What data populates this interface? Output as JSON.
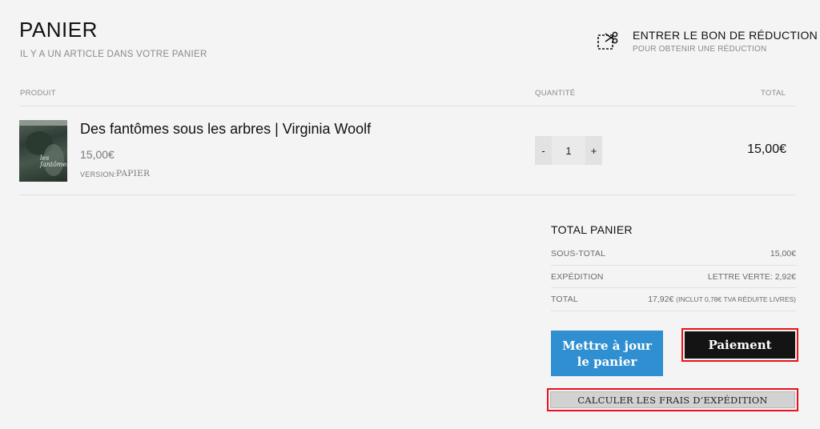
{
  "header": {
    "title": "PANIER",
    "subtitle": "IL Y A UN ARTICLE DANS VOTRE PANIER"
  },
  "coupon": {
    "icon": "scissors-coupon-icon",
    "title": "ENTRER LE BON DE RÉDUCTION",
    "subtitle": "POUR OBTENIR UNE RÉDUCTION"
  },
  "table": {
    "headers": {
      "product": "PRODUIT",
      "quantity": "QUANTITÉ",
      "total": "TOTAL"
    },
    "items": [
      {
        "title": "Des fantômes sous les arbres | Virginia Woolf",
        "price": "15,00€",
        "version_label": "VERSION:",
        "version_value": "PAPIER",
        "cover_text": "les fantômes",
        "quantity": "1",
        "minus": "-",
        "plus": "+",
        "total": "15,00€"
      }
    ]
  },
  "totals": {
    "title": "TOTAL PANIER",
    "subtotal_label": "SOUS-TOTAL",
    "subtotal_value": "15,00€",
    "shipping_label": "EXPÉDITION",
    "shipping_value": "LETTRE VERTE: 2,92€",
    "total_label": "TOTAL",
    "total_value": "17,92€",
    "total_note": "(INCLUT 0,78€ TVA RÉDUITE LIVRES)"
  },
  "actions": {
    "update": "Mettre à jour le panier",
    "pay": "Paiement",
    "shipping_calc": "CALCULER LES FRAIS D’EXPÉDITION"
  },
  "colors": {
    "update_button": "#2f8fd1",
    "pay_button": "#141414",
    "highlight_outline": "#e8121b"
  }
}
